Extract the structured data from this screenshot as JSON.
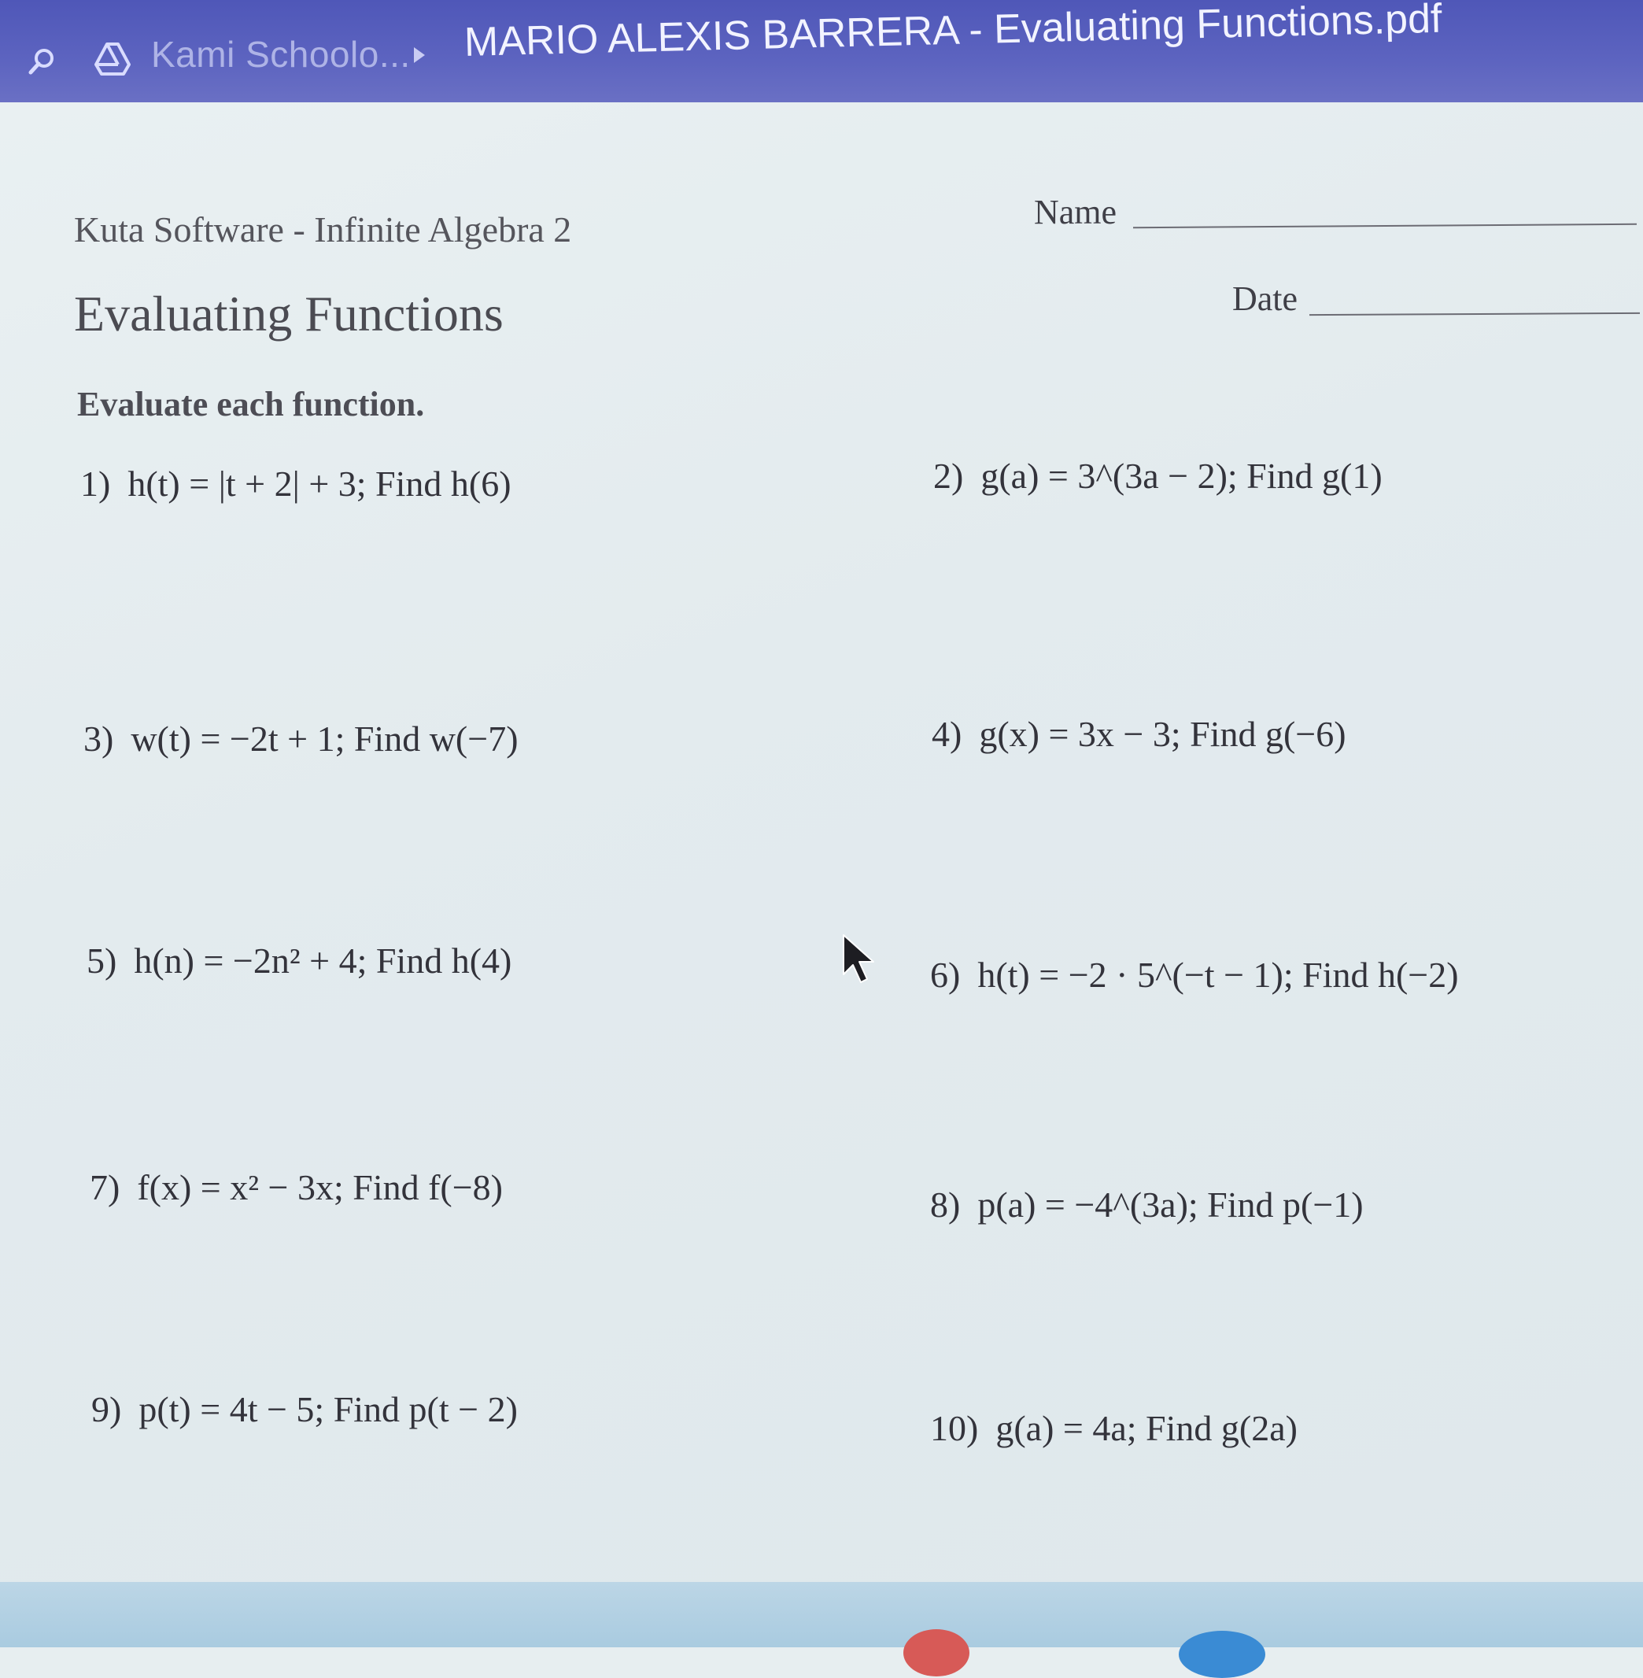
{
  "topbar": {
    "folder_label": "Kami Schoolo...",
    "document_title": "MARIO ALEXIS BARRERA - Evaluating Functions.pdf"
  },
  "worksheet": {
    "publisher": "Kuta Software - Infinite Algebra 2",
    "title": "Evaluating Functions",
    "instructions": "Evaluate each function.",
    "name_label": "Name",
    "date_label": "Date"
  },
  "problems": [
    {
      "number": "1)",
      "expr": "h(t) = |t + 2| + 3; Find h(6)"
    },
    {
      "number": "2)",
      "expr": "g(a) = 3^(3a − 2); Find g(1)"
    },
    {
      "number": "3)",
      "expr": "w(t) = −2t + 1; Find w(−7)"
    },
    {
      "number": "4)",
      "expr": "g(x) = 3x − 3; Find g(−6)"
    },
    {
      "number": "5)",
      "expr": "h(n) = −2n² + 4; Find h(4)"
    },
    {
      "number": "6)",
      "expr": "h(t) = −2 · 5^(−t − 1); Find h(−2)"
    },
    {
      "number": "7)",
      "expr": "f(x) = x² − 3x; Find f(−8)"
    },
    {
      "number": "8)",
      "expr": "p(a) = −4^(3a); Find p(−1)"
    },
    {
      "number": "9)",
      "expr": "p(t) = 4t − 5; Find p(t − 2)"
    },
    {
      "number": "10)",
      "expr": "g(a) = 4a; Find g(2a)"
    }
  ],
  "icons": {
    "search": "search-icon",
    "drive": "drive-icon",
    "breadcrumb_separator": "chevron-right-icon",
    "cursor": "mouse-pointer-icon"
  },
  "colors": {
    "topbar": "#5b62bf",
    "page": "#e5ecef",
    "text": "#33333b"
  }
}
